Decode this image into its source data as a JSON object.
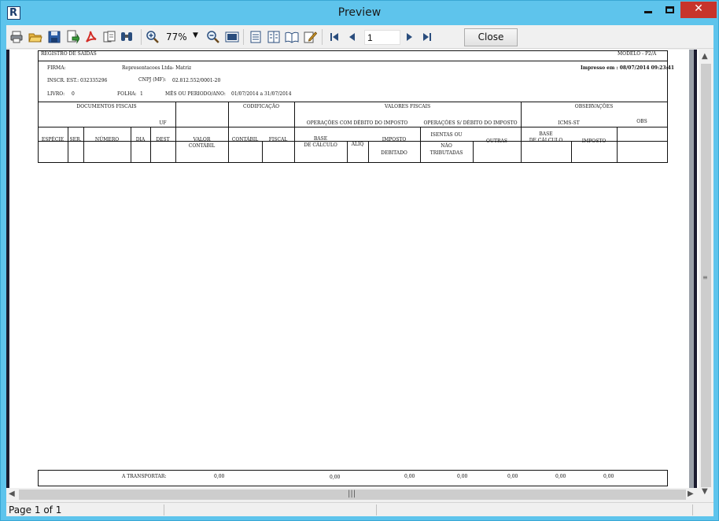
{
  "window": {
    "title": "Preview",
    "app_icon": "R"
  },
  "toolbar": {
    "tools": [
      "print-icon",
      "open-icon",
      "save-icon",
      "export-icon",
      "pdf-icon",
      "find-icon",
      "binoculars-icon",
      "zoom-in-icon",
      "zoom-out-icon",
      "page-width-icon",
      "one-page-icon",
      "two-pages-icon",
      "book-icon",
      "edit-icon",
      "first-page-icon",
      "prev-page-icon",
      "next-page-icon",
      "last-page-icon"
    ],
    "zoom": "77%",
    "page_number": "1",
    "close_label": "Close"
  },
  "report": {
    "title": "REGISTRO DE SAÍDAS",
    "modelo": "MODELO - P2/A",
    "firma_label": "FIRMA:",
    "firma_value": "Representacoes Ltda- Matriz",
    "impresso": "Impresso em : 08/07/2014 09:23:41",
    "inscr_label": "INSCR. EST.:",
    "inscr_value": "032335296",
    "cnpj_label": "CNPJ (MF):",
    "cnpj_value": "02.812.552/0001-20",
    "livro_label": "LIVRO:",
    "livro_value": "0",
    "folha_label": "FOLHA:",
    "folha_value": "1",
    "periodo_label": "MÊS OU PERIODO/ANO:",
    "periodo_value": "01/07/2014 a 31/07/2014",
    "headers": {
      "documentos_fiscais": "DOCUMENTOS FISCAIS",
      "codificacao": "CODIFICAÇÃO",
      "valores_fiscais": "VALORES FISCAIS",
      "observacoes": "OBSERVAÇÕES",
      "uf": "UF",
      "op_com_debito": "OPERAÇÕES COM DÉBITO DO IMPOSTO",
      "op_sem_debito": "OPERAÇÕES S/ DÉBITO DO IMPOSTO",
      "icms_st": "ICMS-ST",
      "obs": "OBS",
      "especie": "ESPÉCIE",
      "ser": "SER.",
      "numero": "NÚMERO",
      "dia": "DIA",
      "dest": "DEST",
      "valor": "VALOR",
      "contabil_2": "CONTÁBIL",
      "contabil": "CONTÁBIL",
      "fiscal": "FISCAL",
      "base": "BASE",
      "de_calculo": "DE CÁLCULO",
      "aliq": "ALIQ",
      "imposto": "IMPOSTO",
      "debitado": "DEBITADO",
      "isentas_ou": "ISENTAS OU",
      "nao": "NÃO",
      "tributadas": "TRIBUTADAS",
      "outras": "OUTRAS",
      "base_st": "BASE",
      "de_calculo_st": "DE CÁLCULO",
      "imposto_st": "IMPOSTO"
    },
    "footer": {
      "label": "A TRANSPORTAR:",
      "values": [
        "0,00",
        "0,00",
        "0,00",
        "0,00",
        "0,00",
        "0,00",
        "0,00"
      ]
    }
  },
  "status": {
    "page_text": "Page 1 of 1"
  }
}
